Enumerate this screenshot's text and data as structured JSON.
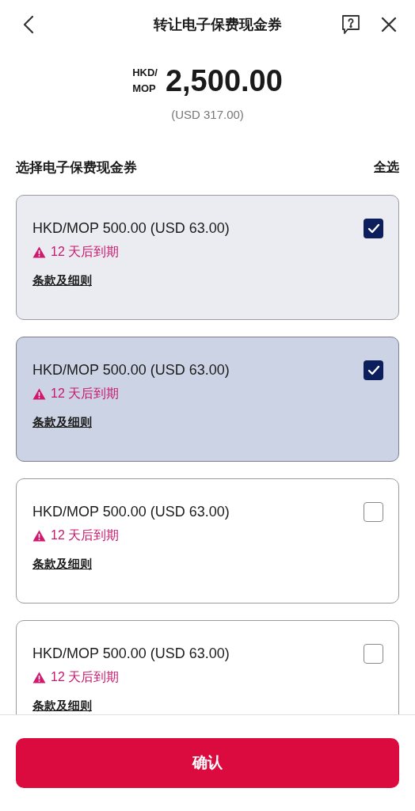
{
  "header": {
    "title": "转让电子保费现金券"
  },
  "amount": {
    "currency_top": "HKD/",
    "currency_bottom": "MOP",
    "value": "2,500.00",
    "usd": "(USD 317.00)"
  },
  "section": {
    "label": "选择电子保费现金券",
    "select_all": "全选"
  },
  "vouchers": [
    {
      "amount": "HKD/MOP 500.00 (USD 63.00)",
      "expiry": "12 天后到期",
      "terms": "条款及细则",
      "checked": true,
      "highlighted": false
    },
    {
      "amount": "HKD/MOP 500.00 (USD 63.00)",
      "expiry": "12 天后到期",
      "terms": "条款及细则",
      "checked": true,
      "highlighted": true
    },
    {
      "amount": "HKD/MOP 500.00 (USD 63.00)",
      "expiry": "12 天后到期",
      "terms": "条款及细则",
      "checked": false,
      "highlighted": false
    },
    {
      "amount": "HKD/MOP 500.00 (USD 63.00)",
      "expiry": "12 天后到期",
      "terms": "条款及细则",
      "checked": false,
      "highlighted": false
    }
  ],
  "confirm_button": "确认"
}
